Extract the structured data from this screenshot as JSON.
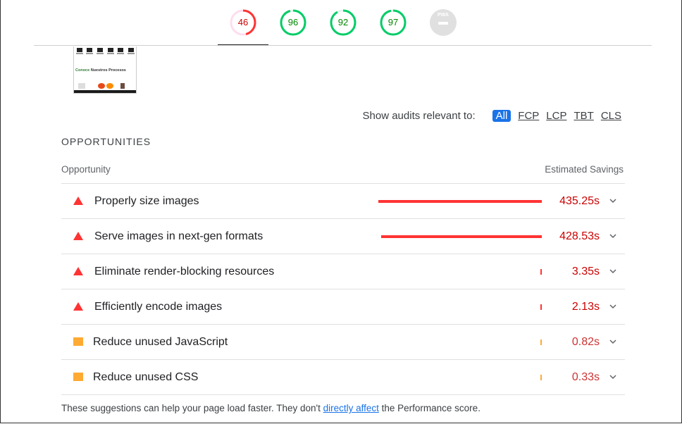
{
  "gauges": [
    {
      "value": "46",
      "score": 0.46,
      "color": "#f33",
      "text_color": "#c00"
    },
    {
      "value": "96",
      "score": 0.96,
      "color": "#0c6",
      "text_color": "#080"
    },
    {
      "value": "92",
      "score": 0.92,
      "color": "#0c6",
      "text_color": "#080"
    },
    {
      "value": "97",
      "score": 0.97,
      "color": "#0c6",
      "text_color": "#080"
    }
  ],
  "pwa_badge": "PWA",
  "thumbnail": {
    "title_green": "Conoce",
    "title_rest": " Nuestros Procesos"
  },
  "filter": {
    "label": "Show audits relevant to:",
    "chips": [
      "All",
      "FCP",
      "LCP",
      "TBT",
      "CLS"
    ],
    "active": "All"
  },
  "section_title": "OPPORTUNITIES",
  "columns": {
    "opportunity": "Opportunity",
    "savings": "Estimated Savings"
  },
  "audits": [
    {
      "title": "Properly size images",
      "savings": "435.25s",
      "severity": "fail",
      "bar_fraction": 0.99
    },
    {
      "title": "Serve images in next-gen formats",
      "savings": "428.53s",
      "severity": "fail",
      "bar_fraction": 0.975
    },
    {
      "title": "Eliminate render-blocking resources",
      "savings": "3.35s",
      "severity": "fail",
      "bar_fraction": 0.008
    },
    {
      "title": "Efficiently encode images",
      "savings": "2.13s",
      "severity": "fail",
      "bar_fraction": 0.006
    },
    {
      "title": "Reduce unused JavaScript",
      "savings": "0.82s",
      "severity": "average",
      "bar_fraction": 0.004
    },
    {
      "title": "Reduce unused CSS",
      "savings": "0.33s",
      "severity": "average",
      "bar_fraction": 0.003
    }
  ],
  "colors": {
    "fail": "#f33",
    "average": "#fa3",
    "savings_fail": "#c00",
    "savings_average": "#c33"
  },
  "footer": {
    "text_before": "These suggestions can help your page load faster. They don't ",
    "link": "directly affect",
    "text_after": " the Performance score."
  }
}
